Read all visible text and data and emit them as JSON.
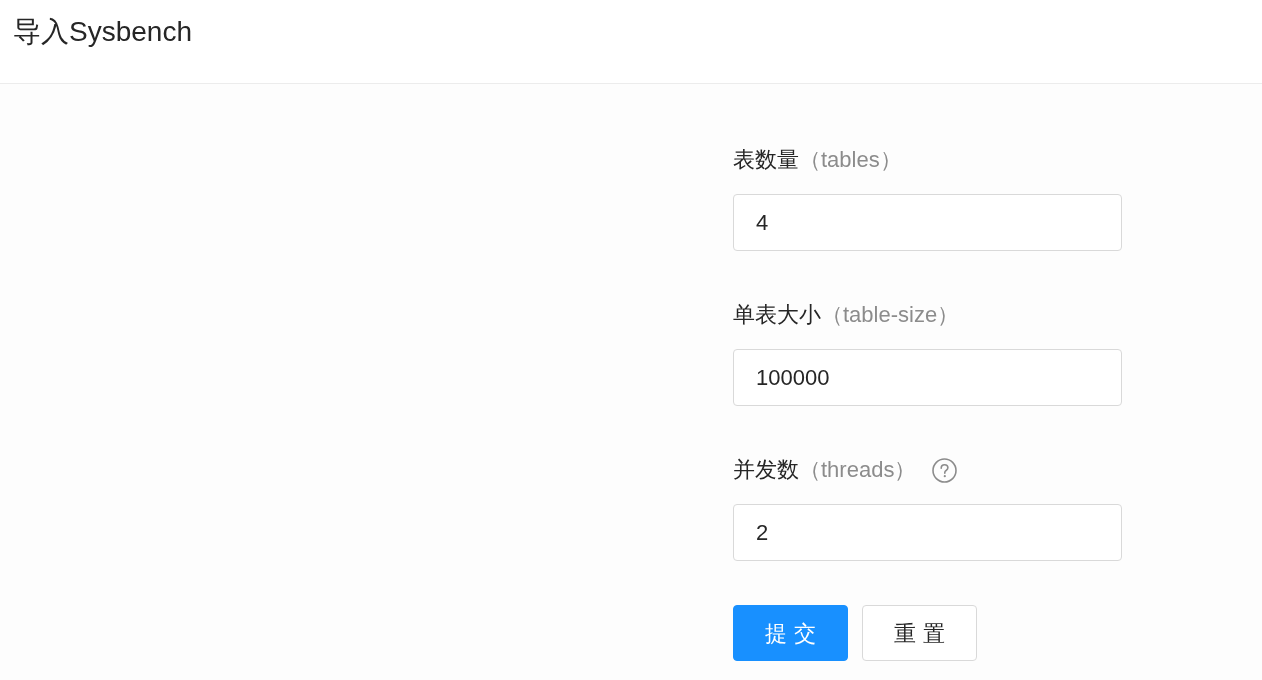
{
  "header": {
    "title": "导入Sysbench"
  },
  "form": {
    "fields": [
      {
        "label": "表数量",
        "hint": "（tables）",
        "value": "4",
        "help": false
      },
      {
        "label": "单表大小",
        "hint": "（table-size）",
        "value": "100000",
        "help": false
      },
      {
        "label": "并发数",
        "hint": "（threads）",
        "value": "2",
        "help": true
      }
    ],
    "buttons": [
      {
        "label": "提 交",
        "kind": "primary"
      },
      {
        "label": "重 置",
        "kind": "default"
      }
    ]
  }
}
